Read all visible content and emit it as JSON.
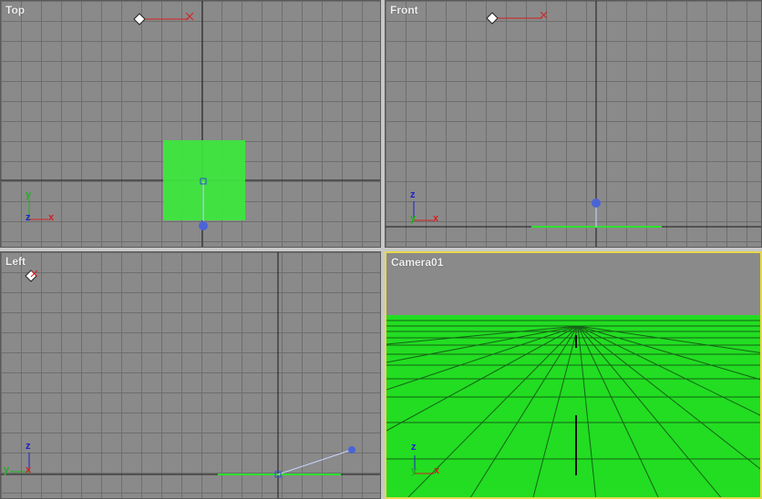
{
  "viewports": {
    "top": {
      "label": "Top",
      "active": false
    },
    "front": {
      "label": "Front",
      "active": false
    },
    "left": {
      "label": "Left",
      "active": false
    },
    "camera": {
      "label": "Camera01",
      "active": true
    }
  },
  "axis_labels": {
    "x": "x",
    "y": "y",
    "z": "z"
  },
  "colors": {
    "viewport_bg": "#8a8a8a",
    "grid_minor": "#6e6e6e",
    "grid_major": "#4a4a4a",
    "active_border": "#e8d84a",
    "plane_green": "#2ee02e",
    "axis_x": "#d42020",
    "axis_y": "#20b020",
    "axis_z": "#2020c8",
    "light_blue": "#4a64d8"
  }
}
